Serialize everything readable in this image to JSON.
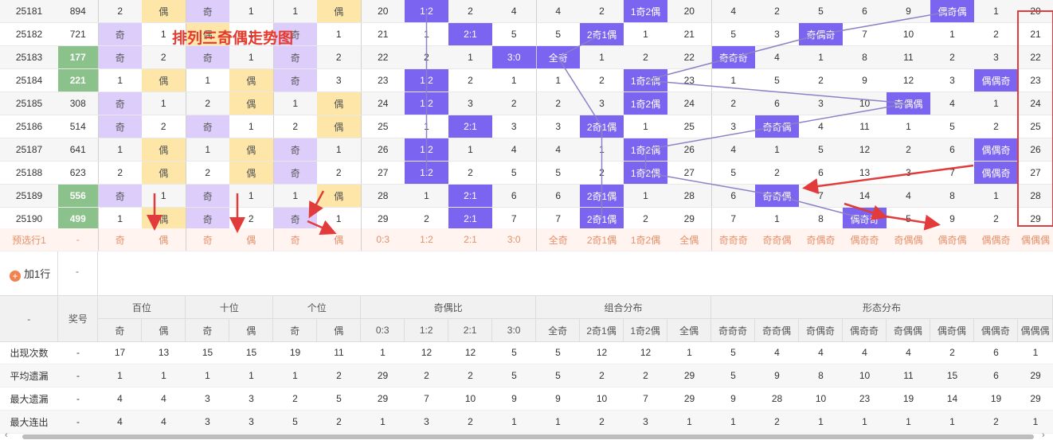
{
  "title": "排列三奇偶走势图",
  "rows": [
    {
      "period": "25181",
      "num": "894",
      "green": false,
      "bai": [
        "2",
        "偶"
      ],
      "shi": [
        "奇",
        "1"
      ],
      "ge": [
        "1",
        "偶"
      ],
      "ratio": [
        "20",
        "1:2",
        "2",
        "4"
      ],
      "combo": [
        "4",
        "2",
        "1奇2偶",
        "20"
      ],
      "form": [
        "4",
        "2",
        "5",
        "6",
        "9",
        "偶奇偶",
        "1",
        "20"
      ]
    },
    {
      "period": "25182",
      "num": "721",
      "green": false,
      "bai": [
        "奇",
        "1"
      ],
      "shi": [
        "偶",
        "1"
      ],
      "ge": [
        "奇",
        "1"
      ],
      "ratio": [
        "21",
        "1",
        "2:1",
        "5"
      ],
      "combo": [
        "5",
        "2奇1偶",
        "1",
        "21"
      ],
      "form": [
        "5",
        "3",
        "奇偶奇",
        "7",
        "10",
        "1",
        "2",
        "21"
      ]
    },
    {
      "period": "25183",
      "num": "177",
      "green": true,
      "bai": [
        "奇",
        "2"
      ],
      "shi": [
        "奇",
        "1"
      ],
      "ge": [
        "奇",
        "2"
      ],
      "ratio": [
        "22",
        "2",
        "1",
        "3:0"
      ],
      "combo": [
        "全奇",
        "1",
        "2",
        "22"
      ],
      "form": [
        "奇奇奇",
        "4",
        "1",
        "8",
        "11",
        "2",
        "3",
        "22"
      ]
    },
    {
      "period": "25184",
      "num": "221",
      "green": true,
      "bai": [
        "1",
        "偶"
      ],
      "shi": [
        "1",
        "偶"
      ],
      "ge": [
        "奇",
        "3"
      ],
      "ratio": [
        "23",
        "1:2",
        "2",
        "1"
      ],
      "combo": [
        "1",
        "2",
        "1奇2偶",
        "23"
      ],
      "form": [
        "1",
        "5",
        "2",
        "9",
        "12",
        "3",
        "偶偶奇",
        "23"
      ]
    },
    {
      "period": "25185",
      "num": "308",
      "green": false,
      "bai": [
        "奇",
        "1"
      ],
      "shi": [
        "2",
        "偶"
      ],
      "ge": [
        "1",
        "偶"
      ],
      "ratio": [
        "24",
        "1:2",
        "3",
        "2"
      ],
      "combo": [
        "2",
        "3",
        "1奇2偶",
        "24"
      ],
      "form": [
        "2",
        "6",
        "3",
        "10",
        "奇偶偶",
        "4",
        "1",
        "24"
      ]
    },
    {
      "period": "25186",
      "num": "514",
      "green": false,
      "bai": [
        "奇",
        "2"
      ],
      "shi": [
        "奇",
        "1"
      ],
      "ge": [
        "2",
        "偶"
      ],
      "ratio": [
        "25",
        "1",
        "2:1",
        "3"
      ],
      "combo": [
        "3",
        "2奇1偶",
        "1",
        "25"
      ],
      "form": [
        "3",
        "奇奇偶",
        "4",
        "11",
        "1",
        "5",
        "2",
        "25"
      ]
    },
    {
      "period": "25187",
      "num": "641",
      "green": false,
      "bai": [
        "1",
        "偶"
      ],
      "shi": [
        "1",
        "偶"
      ],
      "ge": [
        "奇",
        "1"
      ],
      "ratio": [
        "26",
        "1:2",
        "1",
        "4"
      ],
      "combo": [
        "4",
        "1",
        "1奇2偶",
        "26"
      ],
      "form": [
        "4",
        "1",
        "5",
        "12",
        "2",
        "6",
        "偶偶奇",
        "26"
      ]
    },
    {
      "period": "25188",
      "num": "623",
      "green": false,
      "bai": [
        "2",
        "偶"
      ],
      "shi": [
        "2",
        "偶"
      ],
      "ge": [
        "奇",
        "2"
      ],
      "ratio": [
        "27",
        "1:2",
        "2",
        "5"
      ],
      "combo": [
        "5",
        "2",
        "1奇2偶",
        "27"
      ],
      "form": [
        "5",
        "2",
        "6",
        "13",
        "3",
        "7",
        "偶偶奇",
        "27"
      ]
    },
    {
      "period": "25189",
      "num": "556",
      "green": true,
      "bai": [
        "奇",
        "1"
      ],
      "shi": [
        "奇",
        "1"
      ],
      "ge": [
        "1",
        "偶"
      ],
      "ratio": [
        "28",
        "1",
        "2:1",
        "6"
      ],
      "combo": [
        "6",
        "2奇1偶",
        "1",
        "28"
      ],
      "form": [
        "6",
        "奇奇偶",
        "7",
        "14",
        "4",
        "8",
        "1",
        "28"
      ]
    },
    {
      "period": "25190",
      "num": "499",
      "green": true,
      "bai": [
        "1",
        "偶"
      ],
      "shi": [
        "奇",
        "2"
      ],
      "ge": [
        "奇",
        "1"
      ],
      "ratio": [
        "29",
        "2",
        "2:1",
        "7"
      ],
      "combo": [
        "7",
        "2奇1偶",
        "2",
        "29"
      ],
      "form": [
        "7",
        "1",
        "8",
        "偶奇奇",
        "5",
        "9",
        "2",
        "29"
      ]
    }
  ],
  "candidate": {
    "label": "预选行1",
    "dash": "-",
    "cells": [
      "奇",
      "偶",
      "奇",
      "偶",
      "奇",
      "偶",
      "0:3",
      "1:2",
      "2:1",
      "3:0",
      "全奇",
      "2奇1偶",
      "1奇2偶",
      "全偶",
      "奇奇奇",
      "奇奇偶",
      "奇偶奇",
      "偶奇奇",
      "奇偶偶",
      "偶奇偶",
      "偶偶奇",
      "偶偶偶"
    ]
  },
  "add_row": {
    "label": "加1行",
    "dash": "-"
  },
  "header": {
    "dash": "-",
    "prize": "奖号",
    "groups": [
      "百位",
      "十位",
      "个位",
      "奇偶比",
      "组合分布",
      "形态分布"
    ],
    "sub": [
      "奇",
      "偶",
      "奇",
      "偶",
      "奇",
      "偶",
      "0:3",
      "1:2",
      "2:1",
      "3:0",
      "全奇",
      "2奇1偶",
      "1奇2偶",
      "全偶",
      "奇奇奇",
      "奇奇偶",
      "奇偶奇",
      "偶奇奇",
      "奇偶偶",
      "偶奇偶",
      "偶偶奇",
      "偶偶偶"
    ]
  },
  "stats": [
    {
      "label": "出现次数",
      "dash": "-",
      "values": [
        "17",
        "13",
        "15",
        "15",
        "19",
        "11",
        "1",
        "12",
        "12",
        "5",
        "5",
        "12",
        "12",
        "1",
        "5",
        "4",
        "4",
        "4",
        "4",
        "2",
        "6",
        "1"
      ]
    },
    {
      "label": "平均遗漏",
      "dash": "-",
      "values": [
        "1",
        "1",
        "1",
        "1",
        "1",
        "2",
        "29",
        "2",
        "2",
        "5",
        "5",
        "2",
        "2",
        "29",
        "5",
        "9",
        "8",
        "10",
        "11",
        "15",
        "6",
        "29"
      ]
    },
    {
      "label": "最大遗漏",
      "dash": "-",
      "values": [
        "4",
        "4",
        "3",
        "3",
        "2",
        "5",
        "29",
        "7",
        "10",
        "9",
        "9",
        "10",
        "7",
        "29",
        "9",
        "28",
        "10",
        "23",
        "19",
        "14",
        "19",
        "29"
      ]
    },
    {
      "label": "最大连出",
      "dash": "-",
      "values": [
        "4",
        "4",
        "3",
        "3",
        "5",
        "2",
        "1",
        "3",
        "2",
        "1",
        "1",
        "2",
        "3",
        "1",
        "1",
        "2",
        "1",
        "1",
        "1",
        "1",
        "2",
        "1"
      ]
    }
  ],
  "colors": {
    "ji": "#dccdfa",
    "ou": "#fde6a8",
    "green": "#8bc18b",
    "blue": "#7b64ef",
    "red": "#e23b3b",
    "line": "#8a84c7"
  }
}
